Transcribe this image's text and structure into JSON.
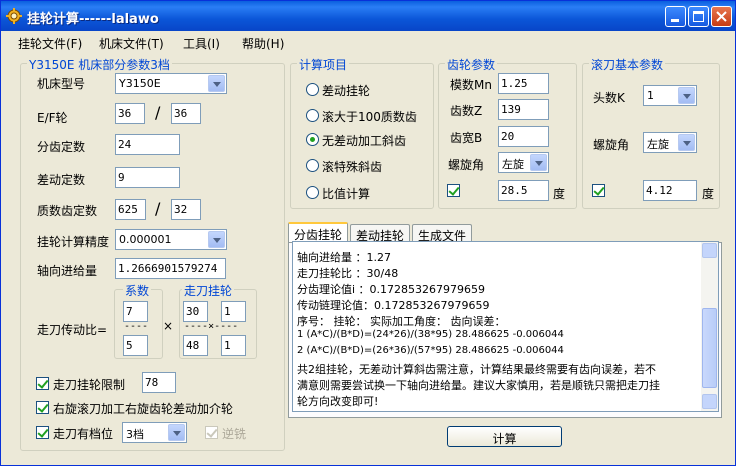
{
  "window": {
    "title": "挂轮计算------lalawo"
  },
  "menu": [
    "挂轮文件(F)",
    "机床文件(T)",
    "工具(I)",
    "帮助(H)"
  ],
  "machine_group": {
    "title": "Y3150E 机床部分参数3档",
    "model_label": "机床型号",
    "model_value": "Y3150E",
    "ef_label": "E/F轮",
    "e_value": "36",
    "f_value": "36",
    "slash": "/",
    "indexing_label": "分齿定数",
    "indexing_value": "24",
    "diff_label": "差动定数",
    "diff_value": "9",
    "prime_label": "质数齿定数",
    "prime_a": "625",
    "prime_b": "32",
    "precision_label": "挂轮计算精度",
    "precision_value": "0.000001",
    "feed_label": "轴向进给量",
    "feed_value": "1.2666901579274",
    "coef_title": "系数",
    "hob_title": "走刀挂轮",
    "hob_ratio_label": "走刀传动比=",
    "coef_top": "7",
    "coef_dash": "----",
    "coef_bottom": "5",
    "times": "×",
    "hob_a": "30",
    "hob_b": "1",
    "hob_c": "48",
    "hob_d": "1",
    "hob_dash": "----×----",
    "limit_label": "走刀挂轮限制",
    "limit_value": "78",
    "rh_label": "右旋滚刀加工右旋齿轮差动加介轮",
    "gear_label": "走刀有档位",
    "gear_value": "3档",
    "climb_label": "逆铣"
  },
  "calc_group": {
    "title": "计算项目",
    "items": [
      "差动挂轮",
      "滚大于100质数齿",
      "无差动加工斜齿",
      "滚特殊斜齿",
      "比值计算"
    ],
    "selected_index": 2
  },
  "gear_group": {
    "title": "齿轮参数",
    "module_label": "模数Mn",
    "module_value": "1.25",
    "teeth_label": "齿数Z",
    "teeth_value": "139",
    "width_label": "齿宽B",
    "width_value": "20",
    "helix_label": "螺旋角",
    "helix_dir": "左旋",
    "angle_value": "28.5",
    "unit": "度"
  },
  "hob_group": {
    "title": "滚刀基本参数",
    "starts_label": "头数K",
    "starts_value": "1",
    "helix_label": "螺旋角",
    "helix_dir": "左旋",
    "angle_value": "4.12",
    "unit": "度"
  },
  "tabs": [
    "分齿挂轮",
    "差动挂轮",
    "生成文件"
  ],
  "output": {
    "lines": [
      "轴向进给量  ：1.27",
      "走刀挂轮比 ：30/48",
      "分齿理论值i ：0.172853267979659",
      "传动链理论值：0.172853267979659",
      "序号：   挂轮：                   实际加工角度：   齿向误差：",
      "1    (A*C)/(B*D)=(24*26)/(38*95)    28.486625    -0.006044",
      "2    (A*C)/(B*D)=(26*36)/(57*95)    28.486625    -0.006044",
      "共2组挂轮，无差动计算斜齿需注意，计算结果最终需要有齿向误差，若不",
      "满意则需要尝试换一下轴向进给量。建议大家慎用，若是顺铣只需把走刀挂",
      "轮方向改变即可!"
    ]
  },
  "calc_button": "计算"
}
